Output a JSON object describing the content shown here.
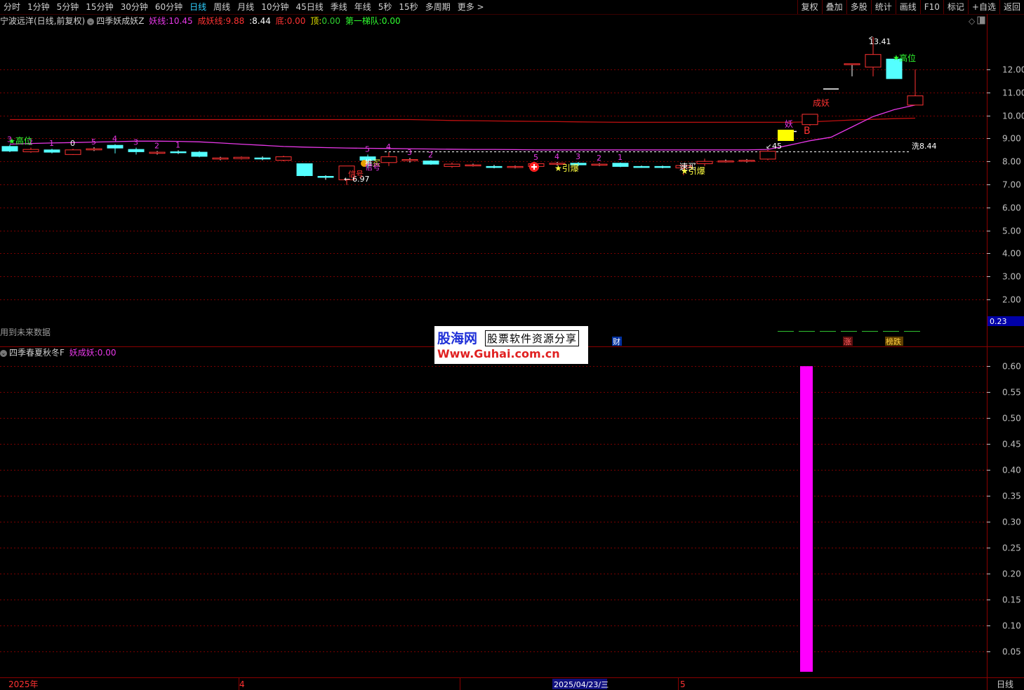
{
  "toolbar": {
    "periods": [
      "分时",
      "1分钟",
      "5分钟",
      "15分钟",
      "30分钟",
      "60分钟",
      "日线",
      "周线",
      "月线",
      "10分钟",
      "45日线",
      "季线",
      "年线",
      "5秒",
      "15秒",
      "多周期",
      "更多 >"
    ],
    "active_period": "日线",
    "right_buttons": [
      "复权",
      "叠加",
      "多股",
      "统计",
      "画线",
      "F10",
      "标记",
      "+自选",
      "返回"
    ]
  },
  "main_info": {
    "stock": "宁波远洋(日线,前复权)",
    "indicator": "四季妖成妖Z",
    "yao_label": "妖线:",
    "yao_value": "10.45",
    "chengyao_label": "成妖线:",
    "chengyao_value": "9.88",
    "close_label": ":",
    "close_value": "8.44",
    "di_label": "底:",
    "di_value": "0.00",
    "ding_label": "顶:",
    "ding_value": "0.00",
    "tidui_label": "第一梯队:",
    "tidui_value": "0.00"
  },
  "sub_info": {
    "indicator": "四季春夏秋冬F",
    "label": "妖成妖:",
    "value": "0.00"
  },
  "future_data_note": "用到未来数据",
  "right_value_badge": "0.23",
  "bottom": {
    "year": "2025年",
    "month4": "4",
    "cursor_date": "2025/04/23/三",
    "month5": "5",
    "period": "日线"
  },
  "watermark": {
    "logo": "股海网",
    "tagline": "股票软件资源分享",
    "url": "Www.Guhai.com.cn"
  },
  "colors": {
    "up": "#ff3232",
    "down": "#54ffff",
    "yao_line": "#e838e8",
    "chengyao_line": "#c01010",
    "grid": "#7a0000",
    "axis": "#c0c0c0",
    "sub_bar": "#ff00ff"
  },
  "chart_data": [
    {
      "type": "candlestick",
      "title": "四季妖成妖Z",
      "ylim": [
        1.6,
        13.8
      ],
      "y_ticks": [
        "12.00",
        "11.00",
        "10.00",
        "9.00",
        "8.00",
        "7.00",
        "6.00",
        "5.00",
        "4.00",
        "3.00",
        "2.00"
      ],
      "candles": [
        {
          "o": 8.65,
          "c": 8.45,
          "h": 8.72,
          "l": 8.4
        },
        {
          "o": 8.42,
          "c": 8.52,
          "h": 8.6,
          "l": 8.38
        },
        {
          "o": 8.5,
          "c": 8.4,
          "h": 8.55,
          "l": 8.35
        },
        {
          "o": 8.3,
          "c": 8.5,
          "h": 8.55,
          "l": 8.28
        },
        {
          "o": 8.5,
          "c": 8.55,
          "h": 8.62,
          "l": 8.45
        },
        {
          "o": 8.7,
          "c": 8.58,
          "h": 8.75,
          "l": 8.35
        },
        {
          "o": 8.52,
          "c": 8.42,
          "h": 8.6,
          "l": 8.3
        },
        {
          "o": 8.35,
          "c": 8.4,
          "h": 8.45,
          "l": 8.3
        },
        {
          "o": 8.42,
          "c": 8.38,
          "h": 8.48,
          "l": 8.32
        },
        {
          "o": 8.4,
          "c": 8.22,
          "h": 8.45,
          "l": 8.18
        },
        {
          "o": 8.1,
          "c": 8.15,
          "h": 8.2,
          "l": 8.05
        },
        {
          "o": 8.12,
          "c": 8.18,
          "h": 8.22,
          "l": 8.08
        },
        {
          "o": 8.15,
          "c": 8.12,
          "h": 8.22,
          "l": 8.05
        },
        {
          "o": 8.05,
          "c": 8.2,
          "h": 8.25,
          "l": 8.0
        },
        {
          "o": 7.9,
          "c": 7.38,
          "h": 7.9,
          "l": 7.35
        },
        {
          "o": 7.35,
          "c": 7.32,
          "h": 7.4,
          "l": 7.2
        },
        {
          "o": 7.2,
          "c": 7.8,
          "h": 7.8,
          "l": 6.97
        },
        {
          "o": 8.2,
          "c": 8.05,
          "h": 8.3,
          "l": 7.7
        },
        {
          "o": 7.95,
          "c": 8.2,
          "h": 8.4,
          "l": 7.8
        },
        {
          "o": 8.05,
          "c": 8.08,
          "h": 8.15,
          "l": 7.95
        },
        {
          "o": 8.02,
          "c": 7.88,
          "h": 8.05,
          "l": 7.85
        },
        {
          "o": 7.78,
          "c": 7.88,
          "h": 7.95,
          "l": 7.72
        },
        {
          "o": 7.82,
          "c": 7.85,
          "h": 7.9,
          "l": 7.78
        },
        {
          "o": 7.78,
          "c": 7.74,
          "h": 7.85,
          "l": 7.7
        },
        {
          "o": 7.75,
          "c": 7.78,
          "h": 7.82,
          "l": 7.7
        },
        {
          "o": 7.78,
          "c": 7.9,
          "h": 7.95,
          "l": 7.75
        },
        {
          "o": 7.88,
          "c": 7.92,
          "h": 7.98,
          "l": 7.82
        },
        {
          "o": 7.92,
          "c": 7.85,
          "h": 7.98,
          "l": 7.8
        },
        {
          "o": 7.84,
          "c": 7.88,
          "h": 7.92,
          "l": 7.8
        },
        {
          "o": 7.92,
          "c": 7.78,
          "h": 7.95,
          "l": 7.75
        },
        {
          "o": 7.78,
          "c": 7.76,
          "h": 7.82,
          "l": 7.72
        },
        {
          "o": 7.78,
          "c": 7.74,
          "h": 7.82,
          "l": 7.7
        },
        {
          "o": 7.72,
          "c": 7.82,
          "h": 7.85,
          "l": 7.4
        },
        {
          "o": 7.9,
          "c": 8.0,
          "h": 8.12,
          "l": 7.8
        },
        {
          "o": 7.98,
          "c": 8.02,
          "h": 8.08,
          "l": 7.95
        },
        {
          "o": 8.0,
          "c": 8.05,
          "h": 8.1,
          "l": 7.95
        },
        {
          "o": 8.1,
          "c": 8.44,
          "h": 8.5,
          "l": 8.05
        },
        {
          "o": 9.3,
          "c": 9.3,
          "h": 9.3,
          "l": 9.3
        },
        {
          "o": 9.6,
          "c": 10.05,
          "h": 10.05,
          "l": 9.55
        },
        {
          "o": 11.15,
          "c": 11.15,
          "h": 11.15,
          "l": 11.15
        },
        {
          "o": 12.25,
          "c": 12.25,
          "h": 12.25,
          "l": 11.7
        },
        {
          "o": 12.1,
          "c": 12.65,
          "h": 13.41,
          "l": 11.7
        },
        {
          "o": 12.45,
          "c": 11.6,
          "h": 12.45,
          "l": 11.6
        },
        {
          "o": 10.45,
          "c": 10.85,
          "h": 12.0,
          "l": 10.45
        }
      ],
      "yao_line": [
        8.75,
        8.78,
        8.8,
        8.82,
        8.84,
        8.86,
        8.88,
        8.88,
        8.87,
        8.85,
        8.8,
        8.75,
        8.7,
        8.65,
        8.62,
        8.6,
        8.58,
        8.57,
        8.56,
        8.55,
        8.54,
        8.53,
        8.52,
        8.52,
        8.51,
        8.5,
        8.5,
        8.5,
        8.5,
        8.5,
        8.5,
        8.5,
        8.5,
        8.5,
        8.5,
        8.5,
        8.52,
        8.7,
        8.9,
        9.05,
        9.5,
        9.95,
        10.25,
        10.45
      ],
      "chengyao_line": [
        9.82,
        9.82,
        9.82,
        9.82,
        9.82,
        9.82,
        9.82,
        9.82,
        9.82,
        9.82,
        9.82,
        9.82,
        9.82,
        9.82,
        9.82,
        9.82,
        9.82,
        9.82,
        9.82,
        9.82,
        9.8,
        9.78,
        9.77,
        9.76,
        9.75,
        9.74,
        9.73,
        9.72,
        9.71,
        9.7,
        9.7,
        9.7,
        9.7,
        9.7,
        9.7,
        9.7,
        9.7,
        9.7,
        9.72,
        9.76,
        9.8,
        9.83,
        9.86,
        9.88
      ],
      "count_labels": [
        {
          "i": 0,
          "t": "3",
          "c": "#e838e8"
        },
        {
          "i": 1,
          "t": "2",
          "c": "#e838e8"
        },
        {
          "i": 2,
          "t": "1",
          "c": "#e838e8"
        },
        {
          "i": 3,
          "t": "0",
          "c": "#ffffff"
        },
        {
          "i": 4,
          "t": "5",
          "c": "#e838e8"
        },
        {
          "i": 5,
          "t": "4",
          "c": "#e838e8"
        },
        {
          "i": 6,
          "t": "3",
          "c": "#e838e8"
        },
        {
          "i": 7,
          "t": "2",
          "c": "#e838e8"
        },
        {
          "i": 8,
          "t": "1",
          "c": "#e838e8"
        },
        {
          "i": 17,
          "t": "5",
          "c": "#e838e8"
        },
        {
          "i": 18,
          "t": "4",
          "c": "#e838e8"
        },
        {
          "i": 19,
          "t": "3",
          "c": "#e838e8"
        },
        {
          "i": 20,
          "t": "2",
          "c": "#e838e8"
        },
        {
          "i": 25,
          "t": "5",
          "c": "#e838e8"
        },
        {
          "i": 26,
          "t": "4",
          "c": "#e838e8"
        },
        {
          "i": 27,
          "t": "3",
          "c": "#e838e8"
        },
        {
          "i": 28,
          "t": "2",
          "c": "#e838e8"
        },
        {
          "i": 29,
          "t": "1",
          "c": "#e838e8"
        }
      ],
      "annotations": {
        "gaowei_left": "高位",
        "low_price": "6.97",
        "tuibo": "推",
        "maimai": "买",
        "xinhao": "信号",
        "yinbao1": "★引爆",
        "subai": "速买",
        "yinbao2": "★引爆",
        "yao_mark": "妖",
        "b_mark": "B",
        "chengyao": "成妖",
        "gaowei_right": "高位",
        "high_price": "13.41",
        "xi_level": "洗8.44",
        "xi_value": 8.44,
        "marker_45": "45",
        "cai": "财",
        "zhang": "涨",
        "bangdie": "榜跌"
      }
    },
    {
      "type": "bar",
      "title": "四季春夏秋冬F",
      "series": [
        {
          "name": "妖成妖",
          "index": 38,
          "value": 0.6
        }
      ],
      "ylim": [
        0,
        0.63
      ],
      "y_ticks": [
        "0.60",
        "0.55",
        "0.50",
        "0.45",
        "0.40",
        "0.35",
        "0.30",
        "0.25",
        "0.20",
        "0.15",
        "0.10",
        "0.05"
      ]
    }
  ]
}
